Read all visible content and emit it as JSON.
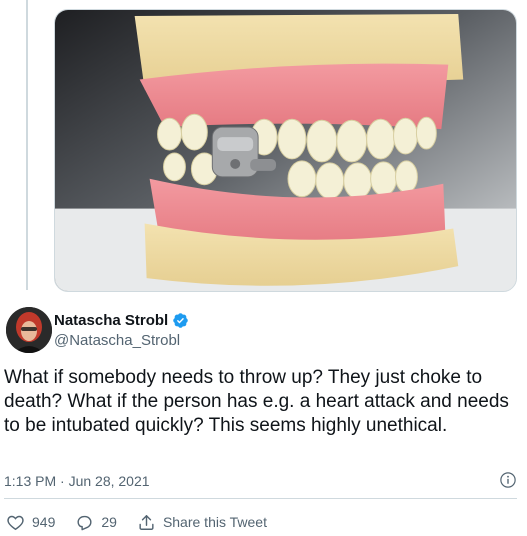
{
  "media": {
    "alt_icon": "photo-denture-model-with-magnetic-lock"
  },
  "author": {
    "display_name": "Natascha Strobl",
    "handle": "@Natascha_Strobl",
    "verified_icon": "verified-badge-icon"
  },
  "tweet": {
    "text": "What if somebody needs to throw up? They just choke to death? What if the person has e.g. a heart attack and needs to be intubated quickly? This seems highly unethical.",
    "timestamp": "1:13 PM · Jun 28, 2021"
  },
  "actions": {
    "likes": "949",
    "replies": "29",
    "share_label": "Share this Tweet"
  },
  "colors": {
    "accent": "#1d9bf0",
    "muted": "#536471",
    "border": "#cfd9de"
  }
}
